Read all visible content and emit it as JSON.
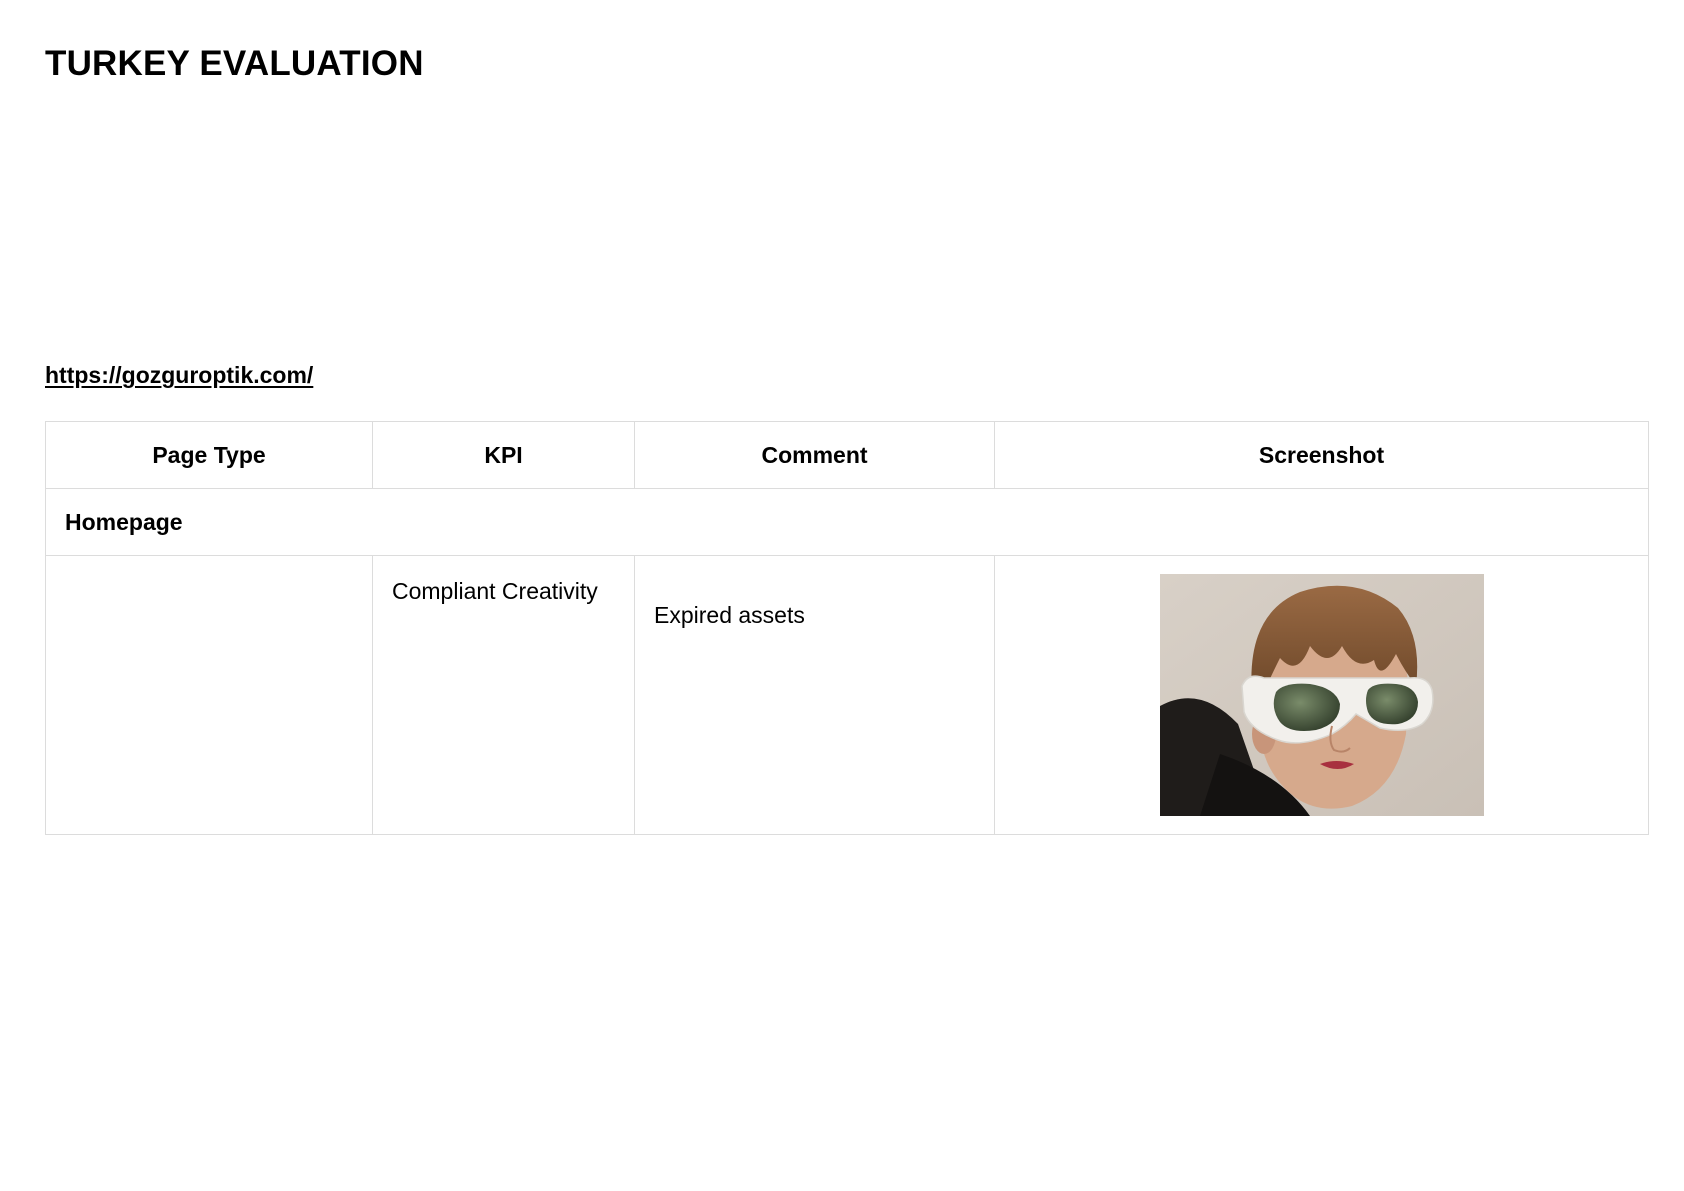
{
  "document": {
    "title": "TURKEY EVALUATION",
    "url": "https://gozguroptik.com/"
  },
  "table": {
    "headers": [
      "Page Type",
      "KPI",
      "Comment",
      "Screenshot"
    ],
    "sections": [
      {
        "name": "Homepage",
        "rows": [
          {
            "page_type": "",
            "kpi": "Compliant Creativity",
            "comment": "Expired assets",
            "screenshot": "photo-woman-white-sunglasses"
          }
        ]
      }
    ]
  },
  "colors": {
    "border": "#dcdcdc",
    "text": "#000000",
    "background": "#ffffff"
  }
}
